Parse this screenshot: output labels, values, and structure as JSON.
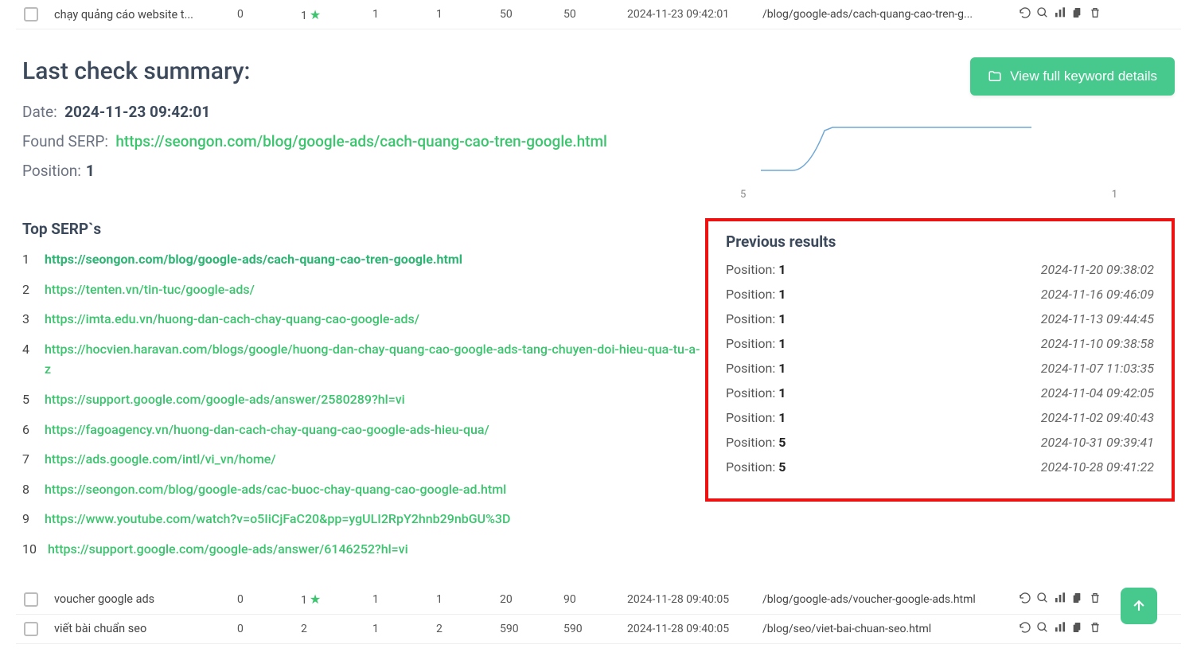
{
  "header_row": {
    "keyword": "chạy quảng cáo website t...",
    "col_a": "0",
    "rank": "1",
    "col_c": "1",
    "col_d": "1",
    "col_e": "50",
    "col_f": "50",
    "timestamp": "2024-11-23 09:42:01",
    "url": "/blog/google-ads/cach-quang-cao-tren-g..."
  },
  "summary": {
    "title": "Last check summary:",
    "date_label": "Date:",
    "date_value": "2024-11-23 09:42:01",
    "serp_label": "Found SERP:",
    "serp_url": "https://seongon.com/blog/google-ads/cach-quang-cao-tren-google.html",
    "pos_label": "Position:",
    "pos_value": "1"
  },
  "button_view": "View full keyword details",
  "chart_data": {
    "type": "line",
    "x": [
      0,
      1,
      2,
      3,
      4,
      5,
      6,
      7,
      8,
      9
    ],
    "values": [
      5,
      5,
      1,
      1,
      1,
      1,
      1,
      1,
      1,
      1
    ],
    "ylim": [
      1,
      5
    ],
    "xlabel": "",
    "ylabel": "",
    "left_tick": "5",
    "right_tick": "1"
  },
  "top_serps": {
    "title": "Top SERP`s",
    "items": [
      "https://seongon.com/blog/google-ads/cach-quang-cao-tren-google.html",
      "https://tenten.vn/tin-tuc/google-ads/",
      "https://imta.edu.vn/huong-dan-cach-chay-quang-cao-google-ads/",
      "https://hocvien.haravan.com/blogs/google/huong-dan-chay-quang-cao-google-ads-tang-chuyen-doi-hieu-qua-tu-a-z",
      "https://support.google.com/google-ads/answer/2580289?hl=vi",
      "https://fagoagency.vn/huong-dan-cach-chay-quang-cao-google-ads-hieu-qua/",
      "https://ads.google.com/intl/vi_vn/home/",
      "https://seongon.com/blog/google-ads/cac-buoc-chay-quang-cao-google-ad.html",
      "https://www.youtube.com/watch?v=o5IiCjFaC20&pp=ygULI2RpY2hnb29nbGU%3D",
      "https://support.google.com/google-ads/answer/6146252?hl=vi"
    ]
  },
  "previous": {
    "title": "Previous results",
    "rows": [
      {
        "pos": "1",
        "date": "2024-11-20 09:38:02"
      },
      {
        "pos": "1",
        "date": "2024-11-16 09:46:09"
      },
      {
        "pos": "1",
        "date": "2024-11-13 09:44:45"
      },
      {
        "pos": "1",
        "date": "2024-11-10 09:38:58"
      },
      {
        "pos": "1",
        "date": "2024-11-07 11:03:35"
      },
      {
        "pos": "1",
        "date": "2024-11-04 09:42:05"
      },
      {
        "pos": "1",
        "date": "2024-11-02 09:40:43"
      },
      {
        "pos": "5",
        "date": "2024-10-31 09:39:41"
      },
      {
        "pos": "5",
        "date": "2024-10-28 09:41:22"
      }
    ],
    "pos_label": "Position: "
  },
  "footer_rows": [
    {
      "kw": "voucher google ads",
      "a": "0",
      "rank": "1",
      "star": true,
      "c": "1",
      "d": "1",
      "e": "20",
      "f": "90",
      "ts": "2024-11-28 09:40:05",
      "url": "/blog/google-ads/voucher-google-ads.html"
    },
    {
      "kw": "viết bài chuẩn seo",
      "a": "0",
      "rank": "2",
      "star": false,
      "c": "1",
      "d": "2",
      "e": "590",
      "f": "590",
      "ts": "2024-11-28 09:40:05",
      "url": "/blog/seo/viet-bai-chuan-seo.html"
    }
  ]
}
